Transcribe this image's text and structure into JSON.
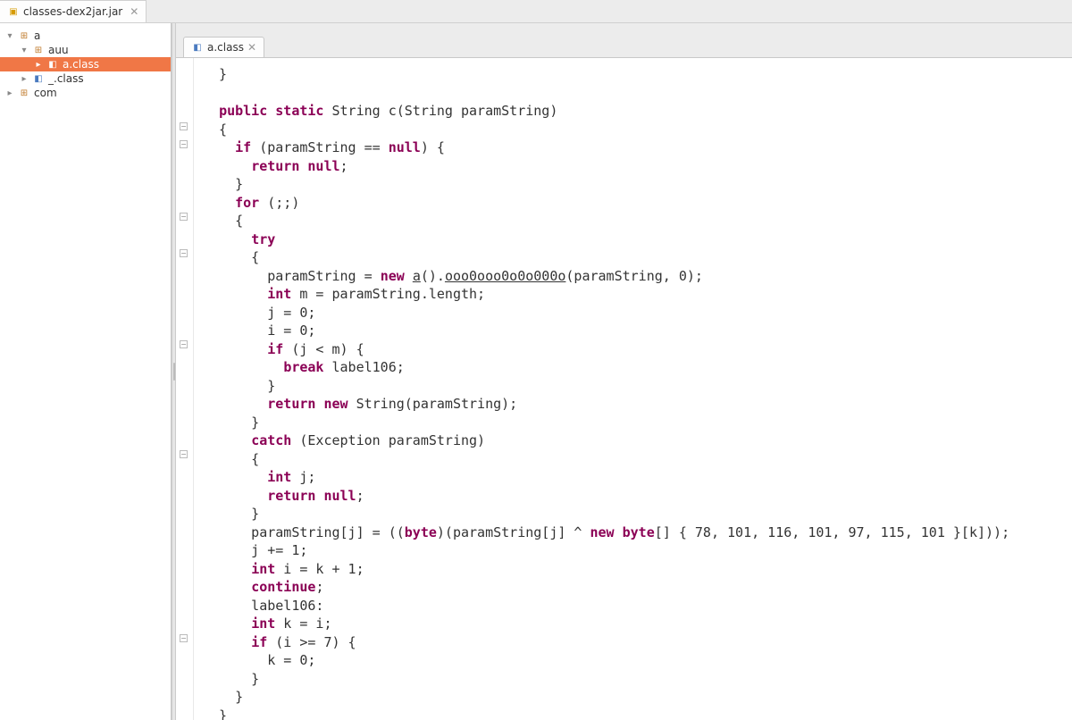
{
  "topTab": {
    "label": "classes-dex2jar.jar"
  },
  "tree": {
    "n0": "a",
    "n1": "auu",
    "n2": "a.class",
    "n3": "_.class",
    "n4": "com"
  },
  "editorTab": {
    "label": "a.class"
  },
  "foldMarks": [
    136,
    156,
    237,
    278,
    380,
    503,
    709
  ],
  "code": {
    "tokens": [
      {
        "i": 1,
        "t": "}"
      },
      {
        "nl": 1
      },
      {
        "nl": 1
      },
      {
        "i": 1,
        "k": "public"
      },
      {
        "t": " "
      },
      {
        "k": "static"
      },
      {
        "t": " String c(String paramString)"
      },
      {
        "nl": 1
      },
      {
        "i": 1,
        "t": "{"
      },
      {
        "nl": 1
      },
      {
        "i": 2,
        "k": "if"
      },
      {
        "t": " (paramString == "
      },
      {
        "k": "null"
      },
      {
        "t": ") {"
      },
      {
        "nl": 1
      },
      {
        "i": 3,
        "k": "return"
      },
      {
        "t": " "
      },
      {
        "k": "null"
      },
      {
        "t": ";"
      },
      {
        "nl": 1
      },
      {
        "i": 2,
        "t": "}"
      },
      {
        "nl": 1
      },
      {
        "i": 2,
        "k": "for"
      },
      {
        "t": " (;;)"
      },
      {
        "nl": 1
      },
      {
        "i": 2,
        "t": "{"
      },
      {
        "nl": 1
      },
      {
        "i": 3,
        "k": "try"
      },
      {
        "nl": 1
      },
      {
        "i": 3,
        "t": "{"
      },
      {
        "nl": 1
      },
      {
        "i": 4,
        "t": "paramString = "
      },
      {
        "k": "new"
      },
      {
        "t": " "
      },
      {
        "u": "a"
      },
      {
        "t": "()."
      },
      {
        "u": "ooo0ooo0o0o000o"
      },
      {
        "t": "(paramString, 0);"
      },
      {
        "nl": 1
      },
      {
        "i": 4,
        "k": "int"
      },
      {
        "t": " m = paramString.length;"
      },
      {
        "nl": 1
      },
      {
        "i": 4,
        "t": "j = 0;"
      },
      {
        "nl": 1
      },
      {
        "i": 4,
        "t": "i = 0;"
      },
      {
        "nl": 1
      },
      {
        "i": 4,
        "k": "if"
      },
      {
        "t": " (j < m) {"
      },
      {
        "nl": 1
      },
      {
        "i": 5,
        "k": "break"
      },
      {
        "t": " label106;"
      },
      {
        "nl": 1
      },
      {
        "i": 4,
        "t": "}"
      },
      {
        "nl": 1
      },
      {
        "i": 4,
        "k": "return"
      },
      {
        "t": " "
      },
      {
        "k": "new"
      },
      {
        "t": " String(paramString);"
      },
      {
        "nl": 1
      },
      {
        "i": 3,
        "t": "}"
      },
      {
        "nl": 1
      },
      {
        "i": 3,
        "k": "catch"
      },
      {
        "t": " (Exception paramString)"
      },
      {
        "nl": 1
      },
      {
        "i": 3,
        "t": "{"
      },
      {
        "nl": 1
      },
      {
        "i": 4,
        "k": "int"
      },
      {
        "t": " j;"
      },
      {
        "nl": 1
      },
      {
        "i": 4,
        "k": "return"
      },
      {
        "t": " "
      },
      {
        "k": "null"
      },
      {
        "t": ";"
      },
      {
        "nl": 1
      },
      {
        "i": 3,
        "t": "}"
      },
      {
        "nl": 1
      },
      {
        "i": 3,
        "t": "paramString[j] = (("
      },
      {
        "k": "byte"
      },
      {
        "t": ")(paramString[j] ^ "
      },
      {
        "k": "new"
      },
      {
        "t": " "
      },
      {
        "k": "byte"
      },
      {
        "t": "[] { 78, 101, 116, 101, 97, 115, 101 }[k]));"
      },
      {
        "nl": 1
      },
      {
        "i": 3,
        "t": "j += 1;"
      },
      {
        "nl": 1
      },
      {
        "i": 3,
        "k": "int"
      },
      {
        "t": " i = k + 1;"
      },
      {
        "nl": 1
      },
      {
        "i": 3,
        "k": "continue"
      },
      {
        "t": ";"
      },
      {
        "nl": 1
      },
      {
        "i": 3,
        "t": "label106:"
      },
      {
        "nl": 1
      },
      {
        "i": 3,
        "k": "int"
      },
      {
        "t": " k = i;"
      },
      {
        "nl": 1
      },
      {
        "i": 3,
        "k": "if"
      },
      {
        "t": " (i >= 7) {"
      },
      {
        "nl": 1
      },
      {
        "i": 4,
        "t": "k = 0;"
      },
      {
        "nl": 1
      },
      {
        "i": 3,
        "t": "}"
      },
      {
        "nl": 1
      },
      {
        "i": 2,
        "t": "}"
      },
      {
        "nl": 1
      },
      {
        "i": 1,
        "t": "}"
      },
      {
        "nl": 1
      }
    ]
  }
}
